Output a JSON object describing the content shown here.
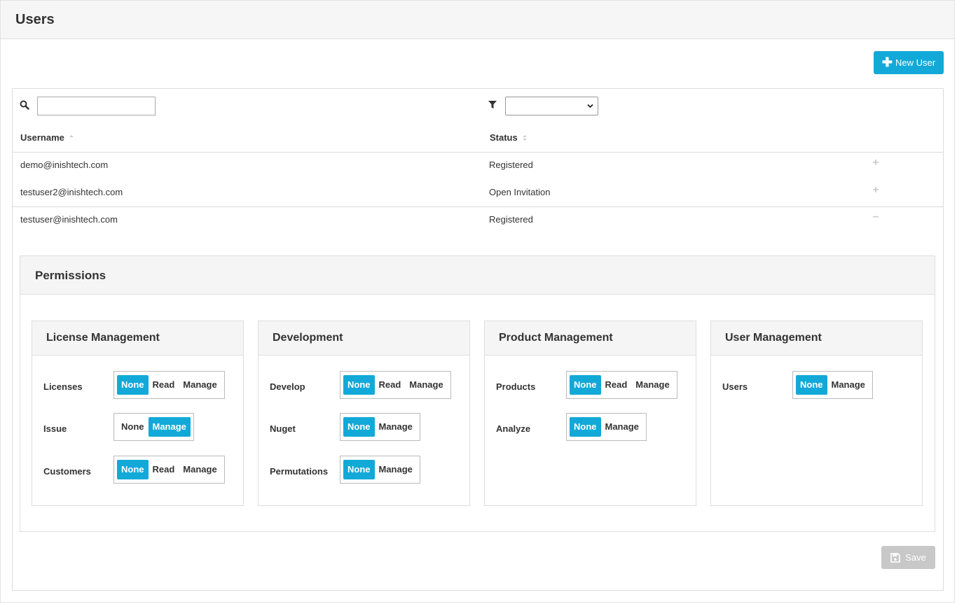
{
  "header": {
    "title": "Users"
  },
  "toolbar": {
    "new_user_label": "New User"
  },
  "search": {
    "value": "",
    "placeholder": ""
  },
  "filter": {
    "selected": ""
  },
  "table": {
    "columns": {
      "username": "Username",
      "status": "Status"
    },
    "rows": [
      {
        "username": "demo@inishtech.com",
        "status": "Registered",
        "expanded": false
      },
      {
        "username": "testuser2@inishtech.com",
        "status": "Open Invitation",
        "expanded": false
      },
      {
        "username": "testuser@inishtech.com",
        "status": "Registered",
        "expanded": true
      }
    ]
  },
  "permissions": {
    "title": "Permissions",
    "groups": [
      {
        "title": "License Management",
        "items": [
          {
            "label": "Licenses",
            "options": [
              "None",
              "Read",
              "Manage"
            ],
            "selected": "None"
          },
          {
            "label": "Issue",
            "options": [
              "None",
              "Manage"
            ],
            "selected": "Manage"
          },
          {
            "label": "Customers",
            "options": [
              "None",
              "Read",
              "Manage"
            ],
            "selected": "None"
          }
        ]
      },
      {
        "title": "Development",
        "items": [
          {
            "label": "Develop",
            "options": [
              "None",
              "Read",
              "Manage"
            ],
            "selected": "None"
          },
          {
            "label": "Nuget",
            "options": [
              "None",
              "Manage"
            ],
            "selected": "None"
          },
          {
            "label": "Permutations",
            "options": [
              "None",
              "Manage"
            ],
            "selected": "None"
          }
        ]
      },
      {
        "title": "Product Management",
        "items": [
          {
            "label": "Products",
            "options": [
              "None",
              "Read",
              "Manage"
            ],
            "selected": "None"
          },
          {
            "label": "Analyze",
            "options": [
              "None",
              "Manage"
            ],
            "selected": "None"
          }
        ]
      },
      {
        "title": "User Management",
        "items": [
          {
            "label": "Users",
            "options": [
              "None",
              "Manage"
            ],
            "selected": "None"
          }
        ]
      }
    ]
  },
  "footer": {
    "save_label": "Save"
  },
  "colors": {
    "accent": "#12a9d9",
    "disabled": "#c8c8c8"
  }
}
